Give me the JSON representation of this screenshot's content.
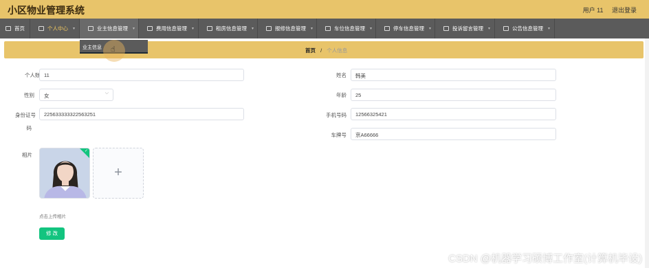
{
  "app": {
    "title": "小区物业管理系统"
  },
  "user": {
    "name": "用户 11",
    "logout": "退出登录"
  },
  "nav": {
    "items": [
      {
        "label": "首页"
      },
      {
        "label": "个人中心"
      },
      {
        "label": "业主信息管理"
      },
      {
        "label": "费用信息管理"
      },
      {
        "label": "租房信息管理"
      },
      {
        "label": "报修信息管理"
      },
      {
        "label": "车位信息管理"
      },
      {
        "label": "停车信息管理"
      },
      {
        "label": "投诉留言管理"
      },
      {
        "label": "公告信息管理"
      }
    ],
    "dropdown_item": "业主信息"
  },
  "breadcrumb": {
    "home": "首页",
    "separator": "/",
    "current": "个人信息"
  },
  "form": {
    "account": {
      "label": "个人账号",
      "value": "11"
    },
    "name": {
      "label": "姓名",
      "value": "韩美"
    },
    "gender": {
      "label": "性别",
      "value": "女"
    },
    "age": {
      "label": "年龄",
      "value": "25"
    },
    "id_card": {
      "label_line1": "身份证号",
      "label_line2": "码",
      "value": "225633333322563251"
    },
    "phone": {
      "label": "手机号码",
      "value": "12566325421"
    },
    "plate": {
      "label": "车牌号",
      "value": "京A66666"
    },
    "photo": {
      "label": "相片",
      "hint": "点击上传相片"
    },
    "submit": "修 改"
  },
  "watermark": "CSDN @机器学习硕博工作室(计算机毕设)",
  "colors": {
    "header": "#e8c46a",
    "nav": "#5b5b5b",
    "primary": "#13c47f",
    "active_nav": "#f0c75e"
  }
}
